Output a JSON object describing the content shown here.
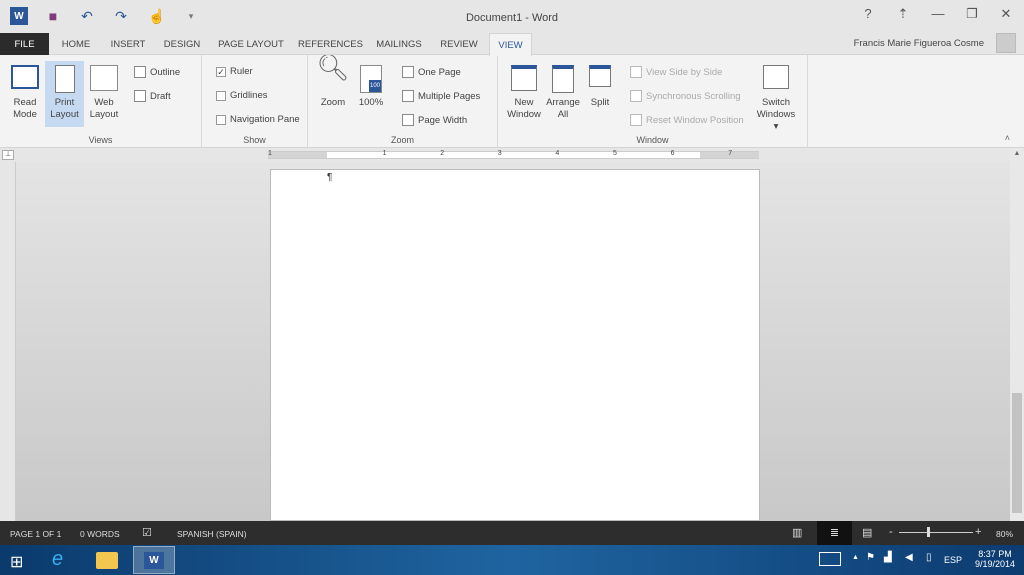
{
  "title": "Document1 - Word",
  "user": "Francis Marie Figueroa Cosme",
  "tabs": [
    "FILE",
    "HOME",
    "INSERT",
    "DESIGN",
    "PAGE LAYOUT",
    "REFERENCES",
    "MAILINGS",
    "REVIEW",
    "VIEW"
  ],
  "views": {
    "label": "Views",
    "read": "Read Mode",
    "print": "Print Layout",
    "web": "Web Layout",
    "outline": "Outline",
    "draft": "Draft"
  },
  "show": {
    "label": "Show",
    "ruler": "Ruler",
    "gridlines": "Gridlines",
    "nav": "Navigation Pane",
    "ruler_checked": true
  },
  "zoom": {
    "label": "Zoom",
    "zoom": "Zoom",
    "pct": "100%",
    "one": "One Page",
    "multi": "Multiple Pages",
    "width": "Page Width",
    "badge": "100"
  },
  "window": {
    "label": "Window",
    "new": "New Window",
    "arrange": "Arrange All",
    "split": "Split",
    "side": "View Side by Side",
    "sync": "Synchronous Scrolling",
    "reset": "Reset Window Position",
    "switch": "Switch Windows"
  },
  "ruler_numbers": [
    "1",
    "1",
    "2",
    "3",
    "4",
    "5",
    "6",
    "7"
  ],
  "pilcrow": "¶",
  "status": {
    "page": "PAGE 1 OF 1",
    "words": "0 WORDS",
    "lang": "SPANISH (SPAIN)",
    "zoom": "80%",
    "zoom_level": 80
  },
  "taskbar": {
    "lang": "ESP",
    "time": "8:37 PM",
    "date": "9/19/2014"
  }
}
